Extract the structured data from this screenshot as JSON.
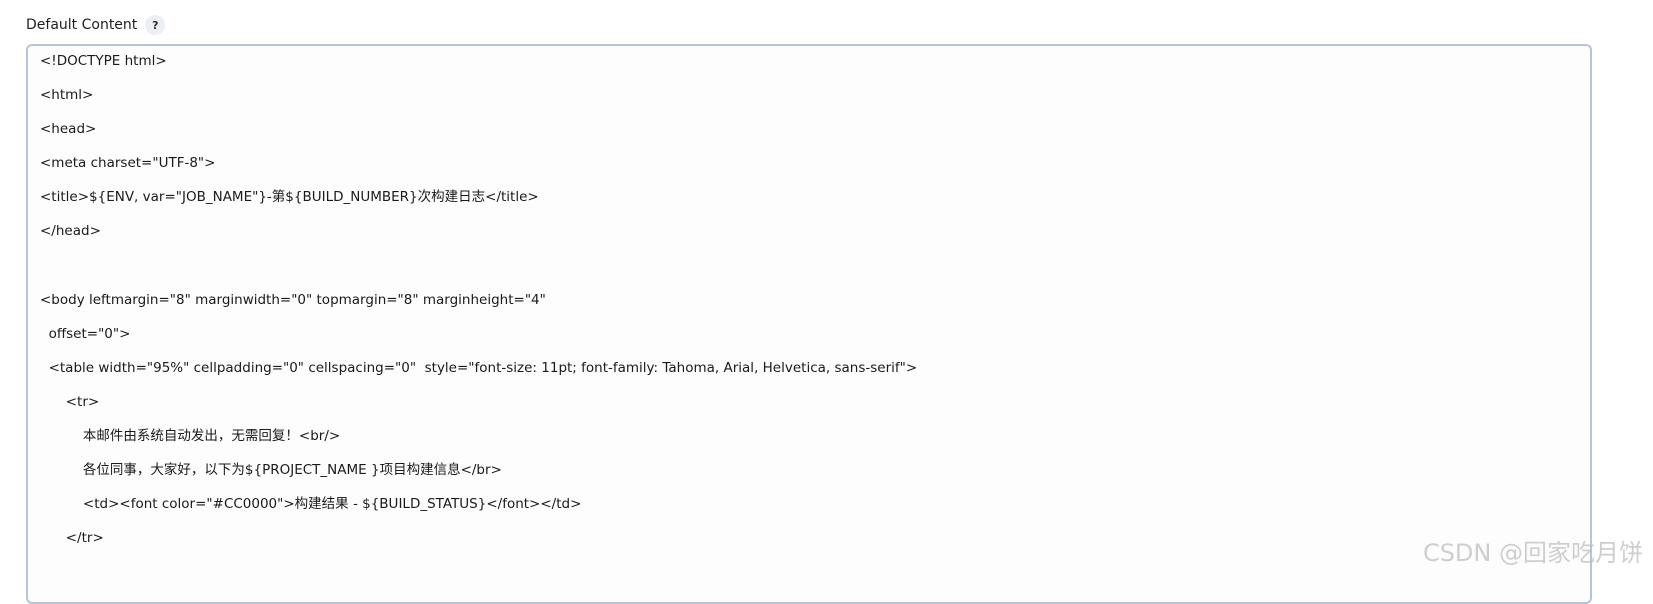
{
  "field": {
    "label": "Default Content",
    "help": "?"
  },
  "editor": {
    "lines": [
      "<!DOCTYPE html>",
      "<html>",
      "<head>",
      "<meta charset=\"UTF-8\">",
      "<title>${ENV, var=\"JOB_NAME\"}-第${BUILD_NUMBER}次构建日志</title>",
      "</head>",
      "<body leftmargin=\"8\" marginwidth=\"0\" topmargin=\"8\" marginheight=\"4\"",
      "  offset=\"0\">",
      "  <table width=\"95%\" cellpadding=\"0\" cellspacing=\"0\"  style=\"font-size: 11pt; font-family: Tahoma, Arial, Helvetica, sans-serif\">",
      "      <tr>",
      "          本邮件由系统自动发出，无需回复！<br/>",
      "          各位同事，大家好，以下为${PROJECT_NAME }项目构建信息</br>",
      "          <td><font color=\"#CC0000\">构建结果 - ${BUILD_STATUS}</font></td>",
      "      </tr>"
    ]
  },
  "watermark": "CSDN @回家吃月饼"
}
